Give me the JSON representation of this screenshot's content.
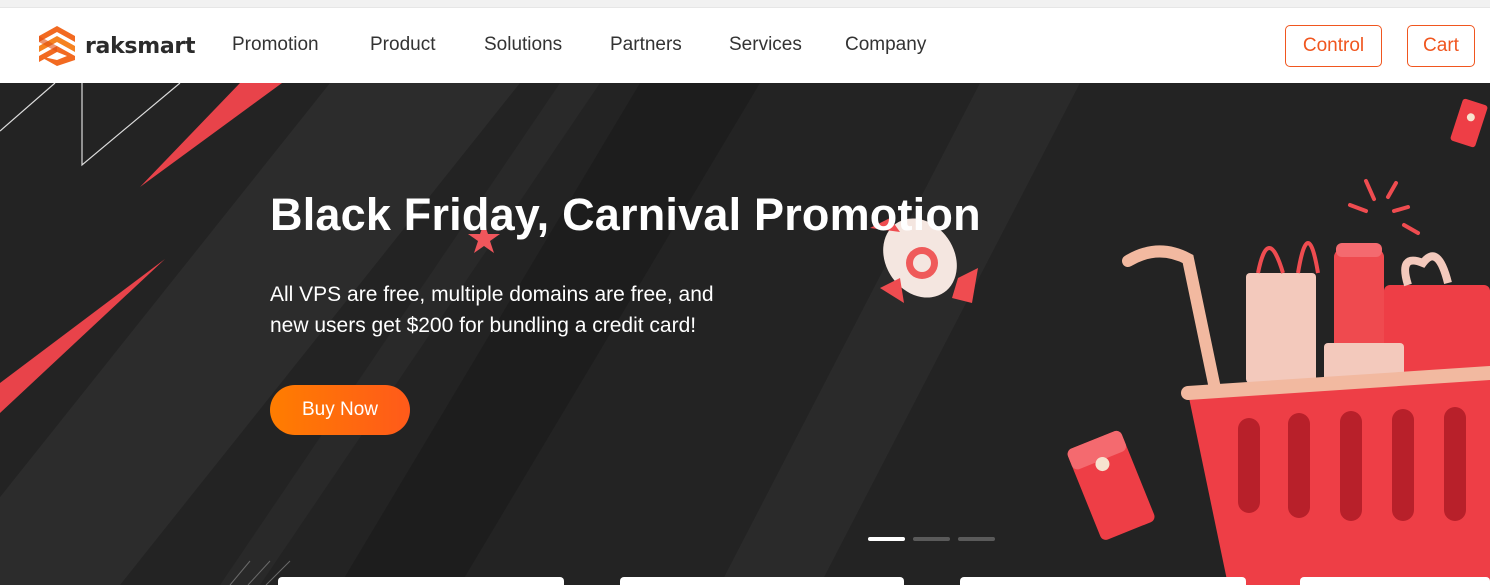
{
  "brand": {
    "name": "raksmart"
  },
  "nav": {
    "items": [
      {
        "label": "Promotion"
      },
      {
        "label": "Product"
      },
      {
        "label": "Solutions"
      },
      {
        "label": "Partners"
      },
      {
        "label": "Services"
      },
      {
        "label": "Company"
      }
    ],
    "control_label": "Control",
    "cart_label": "Cart"
  },
  "hero": {
    "title": "Black Friday, Carnival Promotion",
    "subtitle_line1": "All VPS are free, multiple domains are free, and",
    "subtitle_line2": "new users get $200 for bundling a credit card!",
    "cta_label": "Buy Now",
    "carousel": {
      "slides": 3,
      "active": 1
    }
  },
  "colors": {
    "accent": "#f0561f",
    "hero_bg": "#232323",
    "cta_start": "#ff7d00",
    "cta_end": "#ff5a1a",
    "decor_red": "#e8434a"
  },
  "icons": {
    "logo": "raksmart-logo-icon",
    "illustration_cart": "shopping-cart-illustration",
    "illustration_rocket": "rocket-illustration",
    "illustration_gift": "red-envelope-illustration",
    "illustration_star": "star-illustration"
  }
}
